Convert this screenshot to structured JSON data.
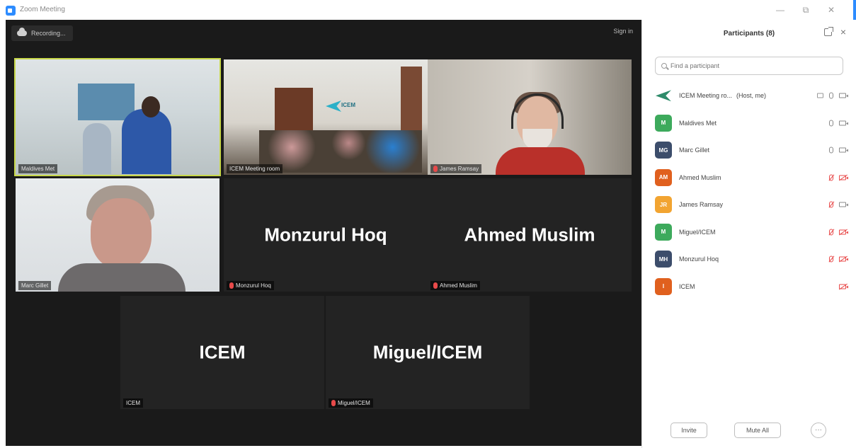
{
  "window": {
    "title": "Zoom Meeting",
    "minimize_glyph": "—",
    "restore_glyph": "⧉",
    "close_glyph": "✕"
  },
  "meeting": {
    "recording_label": "Recording...",
    "signin_label": "Sign in",
    "tiles": [
      {
        "label": "Maldives Met",
        "display_name": "",
        "muted": false,
        "active": true
      },
      {
        "label": "ICEM Meeting room",
        "display_name": "",
        "muted": false
      },
      {
        "label": "James Ramsay",
        "display_name": "",
        "muted": true
      },
      {
        "label": "Marc Gillet",
        "display_name": "",
        "muted": false
      },
      {
        "label": "Monzurul Hoq",
        "display_name": "Monzurul Hoq",
        "muted": true
      },
      {
        "label": "Ahmed Muslim",
        "display_name": "Ahmed Muslim",
        "muted": true
      },
      {
        "label": "ICEM",
        "display_name": "ICEM",
        "muted": false
      },
      {
        "label": "Miguel/ICEM",
        "display_name": "Miguel/ICEM",
        "muted": true
      }
    ],
    "room_logo_text": "ICEM"
  },
  "panel": {
    "title": "Participants (8)",
    "search_placeholder": "Find a participant",
    "participants": [
      {
        "name": "ICEM Meeting ro...",
        "role": "(Host, me)",
        "initials": "",
        "color": "#2e8b6a",
        "mic": "on",
        "cam": "on"
      },
      {
        "name": "Maldives Met",
        "initials": "M",
        "color": "#3daa5c",
        "mic": "on",
        "cam": "on"
      },
      {
        "name": "Marc Gillet",
        "initials": "MG",
        "color": "#3c4d6b",
        "mic": "on",
        "cam": "on"
      },
      {
        "name": "Ahmed Muslim",
        "initials": "AM",
        "color": "#e0601e",
        "mic": "muted",
        "cam": "off"
      },
      {
        "name": "James Ramsay",
        "initials": "JR",
        "color": "#f2a431",
        "mic": "muted",
        "cam": "on"
      },
      {
        "name": "Miguel/ICEM",
        "initials": "M",
        "color": "#3daa5c",
        "mic": "muted",
        "cam": "off"
      },
      {
        "name": "Monzurul Hoq",
        "initials": "MH",
        "color": "#3c4d6b",
        "mic": "muted",
        "cam": "off"
      },
      {
        "name": "ICEM",
        "initials": "I",
        "color": "#e0601e",
        "mic": "none",
        "cam": "off"
      }
    ],
    "invite_label": "Invite",
    "mute_all_label": "Mute All",
    "more_glyph": "···"
  }
}
